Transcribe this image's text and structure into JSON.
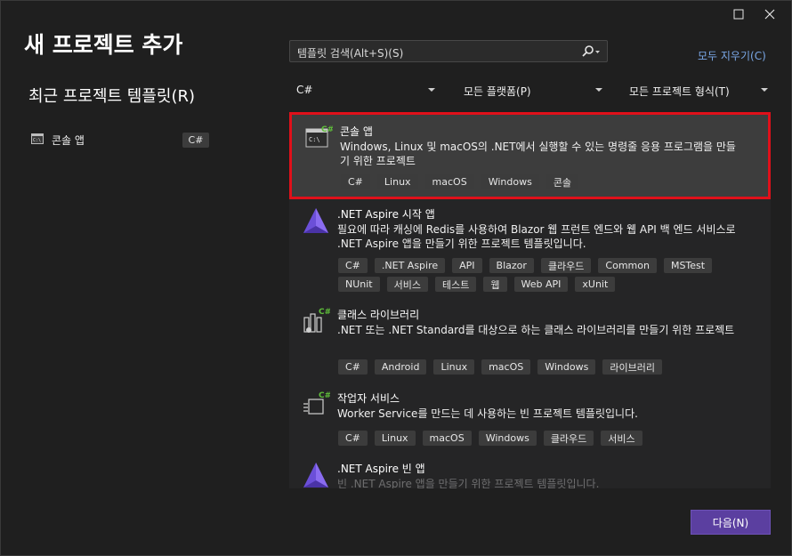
{
  "window": {
    "title": "새 프로젝트 추가",
    "maximize_icon": "maximize-icon",
    "close_icon": "close-icon"
  },
  "left": {
    "recent_title": "최근 프로젝트 템플릿(R)",
    "recent_items": [
      {
        "label": "콘솔 앱",
        "tag": "C#",
        "icon": "console-app-icon"
      }
    ]
  },
  "search": {
    "placeholder": "템플릿 검색(Alt+S)(S)",
    "icon": "search-icon"
  },
  "clear_all": "모두 지우기(C)",
  "filters": {
    "language": "C#",
    "platform": "모든 플랫폼(P)",
    "project_type": "모든 프로젝트 형식(T)"
  },
  "templates": [
    {
      "name": "콘솔 앱",
      "description": "Windows, Linux 및 macOS의 .NET에서 실행할 수 있는 명령줄 응용 프로그램을 만들기 위한 프로젝트",
      "tags": [
        "C#",
        "Linux",
        "macOS",
        "Windows",
        "콘솔"
      ],
      "icon": "console-app-icon",
      "selected": true
    },
    {
      "name": ".NET Aspire 시작 앱",
      "description": "필요에 따라 캐싱에 Redis를 사용하여 Blazor 웹 프런트 엔드와 웹 API 백 엔드 서비스로 .NET Aspire 앱을 만들기 위한 프로젝트 템플릿입니다.",
      "tags": [
        "C#",
        ".NET Aspire",
        "API",
        "Blazor",
        "클라우드",
        "Common",
        "MSTest",
        "NUnit",
        "서비스",
        "테스트",
        "웹",
        "Web API",
        "xUnit"
      ],
      "icon": "aspire-icon"
    },
    {
      "name": "클래스 라이브러리",
      "description": ".NET 또는 .NET Standard를 대상으로 하는 클래스 라이브러리를 만들기 위한 프로젝트",
      "tags": [
        "C#",
        "Android",
        "Linux",
        "macOS",
        "Windows",
        "라이브러리"
      ],
      "icon": "class-library-icon"
    },
    {
      "name": "작업자 서비스",
      "description": "Worker Service를 만드는 데 사용하는 빈 프로젝트 템플릿입니다.",
      "tags": [
        "C#",
        "Linux",
        "macOS",
        "Windows",
        "클라우드",
        "서비스"
      ],
      "icon": "worker-service-icon"
    },
    {
      "name": ".NET Aspire 빈 앱",
      "description": "빈 .NET Aspire 앱을 만들기 위한 프로젝트 템플릿입니다.",
      "tags": [],
      "icon": "aspire-icon"
    }
  ],
  "footer": {
    "next_label": "다음(N)"
  },
  "colors": {
    "background": "#1f1f1f",
    "list_background": "#252526",
    "selected_card": "#3d3d3d",
    "selection_border": "#e0101a",
    "tag_background": "#3c3c3c",
    "link": "#7aa7e6",
    "primary_button": "#5b3fa0",
    "csharp_green": "#5fbf3a",
    "aspire_purple": "#6b4fd8"
  }
}
